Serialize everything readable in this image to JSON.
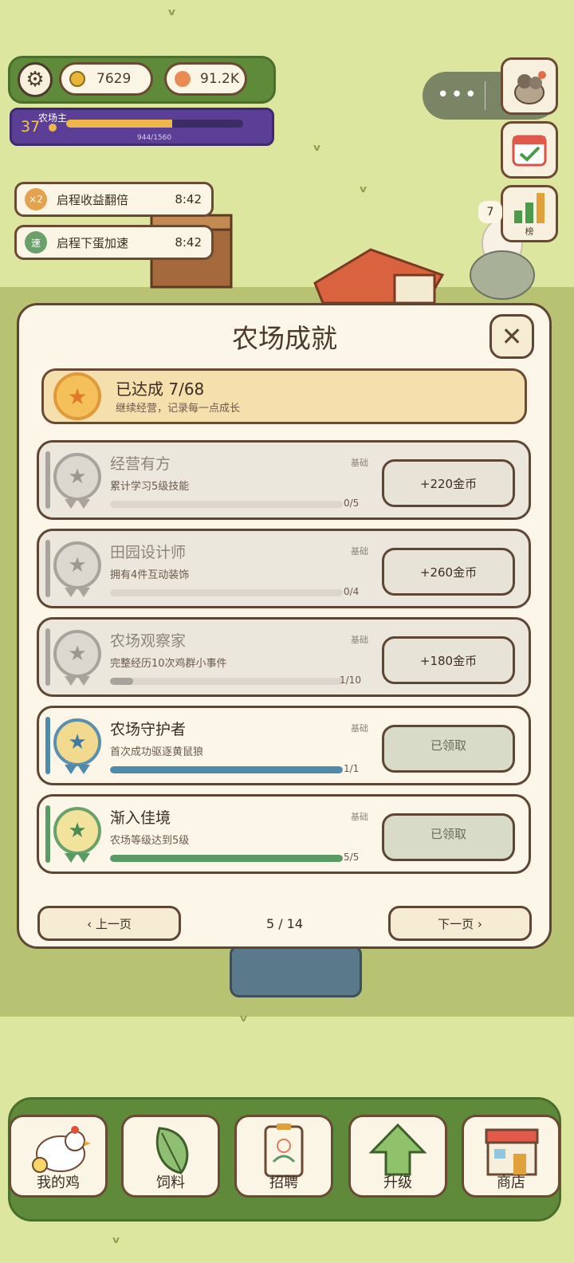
{
  "hud": {
    "coins": "7629",
    "eggs": "91.2K",
    "level": "37",
    "rank_title": "农场主",
    "xp_text": "944/1560",
    "xp_progress": 0.6
  },
  "side": {
    "leaderboard_label": "榜",
    "partial_count": "7"
  },
  "buffs": [
    {
      "icon_text": "×2",
      "label": "启程收益翻倍",
      "time": "8:42",
      "color": "#e2a24e"
    },
    {
      "icon_text": "速",
      "label": "启程下蛋加速",
      "time": "8:42",
      "color": "#6aa06a"
    }
  ],
  "modal": {
    "title": "农场成就",
    "close_icon": "✕",
    "summary": {
      "title": "已达成 7/68",
      "subtitle": "继续经营，记录每一点成长"
    },
    "achievements": [
      {
        "name": "经营有方",
        "tag": "基础",
        "desc": "累计学习5级技能",
        "progress_text": "0/5",
        "progress": 0.0,
        "state": "locked",
        "reward": "+220金币"
      },
      {
        "name": "田园设计师",
        "tag": "基础",
        "desc": "拥有4件互动装饰",
        "progress_text": "0/4",
        "progress": 0.0,
        "state": "locked",
        "reward": "+260金币"
      },
      {
        "name": "农场观察家",
        "tag": "基础",
        "desc": "完整经历10次鸡群小事件",
        "progress_text": "1/10",
        "progress": 0.1,
        "state": "locked",
        "reward": "+180金币"
      },
      {
        "name": "农场守护者",
        "tag": "基础",
        "desc": "首次成功驱逐黄鼠狼",
        "progress_text": "1/1",
        "progress": 1.0,
        "state": "claimed",
        "reward": "已领取"
      },
      {
        "name": "渐入佳境",
        "tag": "基础",
        "desc": "农场等级达到5级",
        "progress_text": "5/5",
        "progress": 1.0,
        "state": "claimed",
        "reward": "已领取"
      }
    ],
    "prev_label": "‹ 上一页",
    "next_label": "下一页 ›",
    "page_indicator": "5 / 14"
  },
  "nav": [
    {
      "label": "我的鸡",
      "icon": "chicken-icon"
    },
    {
      "label": "饲料",
      "icon": "leaf-icon"
    },
    {
      "label": "招聘",
      "icon": "badge-icon"
    },
    {
      "label": "升级",
      "icon": "up-arrow-icon"
    },
    {
      "label": "商店",
      "icon": "shop-icon"
    }
  ],
  "colors": {
    "accent_blue": "#4f8aab",
    "accent_green": "#5a9a64",
    "gray_bar": "#a8a39c"
  }
}
